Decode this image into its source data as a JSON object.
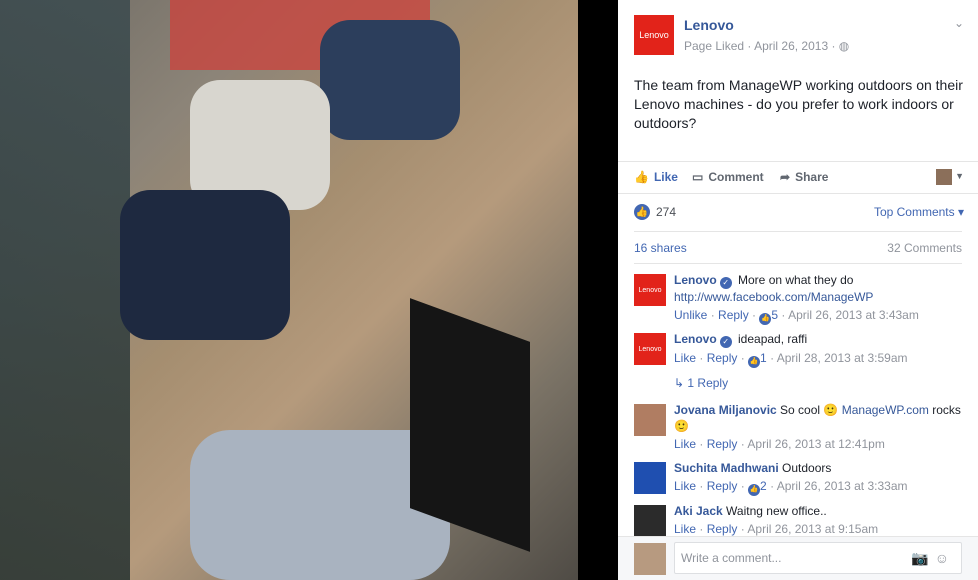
{
  "post": {
    "page_name": "Lenovo",
    "logo_text": "Lenovo",
    "status": "Page Liked",
    "date": "April 26, 2013",
    "text": "The team from ManageWP working outdoors on their Lenovo machines - do you prefer to work indoors or outdoors?",
    "actions": {
      "like": "Like",
      "comment": "Comment",
      "share": "Share"
    },
    "likes": "274",
    "sort_label": "Top Comments",
    "shares": "16 shares",
    "comments_count": "32 Comments"
  },
  "comments": [
    {
      "name": "Lenovo",
      "verified": true,
      "text": "More on what they do",
      "link": "http://www.facebook.com/ManageWP",
      "meta": {
        "a": "Unlike",
        "b": "Reply",
        "likes": "5",
        "time": "April 26, 2013 at 3:43am"
      }
    },
    {
      "name": "Lenovo",
      "verified": true,
      "text": "ideapad, raffi",
      "meta": {
        "a": "Like",
        "b": "Reply",
        "likes": "1",
        "time": "April 28, 2013 at 3:59am"
      },
      "replies": "1 Reply"
    },
    {
      "name": "Jovana Miljanovic",
      "text": "So cool",
      "text2": "ManageWP.com",
      "text3": "rocks",
      "meta": {
        "a": "Like",
        "b": "Reply",
        "time": "April 26, 2013 at 12:41pm"
      }
    },
    {
      "name": "Suchita Madhwani",
      "text": "Outdoors",
      "meta": {
        "a": "Like",
        "b": "Reply",
        "likes": "2",
        "time": "April 26, 2013 at 3:33am"
      }
    },
    {
      "name": "Aki Jack",
      "text": "Waitng new office..",
      "meta": {
        "a": "Like",
        "b": "Reply",
        "time": "April 26, 2013 at 9:15am"
      }
    }
  ],
  "composer": {
    "placeholder": "Write a comment..."
  },
  "colors": {
    "brand": "#e2231a",
    "link": "#365899",
    "accent": "#4267b2"
  }
}
